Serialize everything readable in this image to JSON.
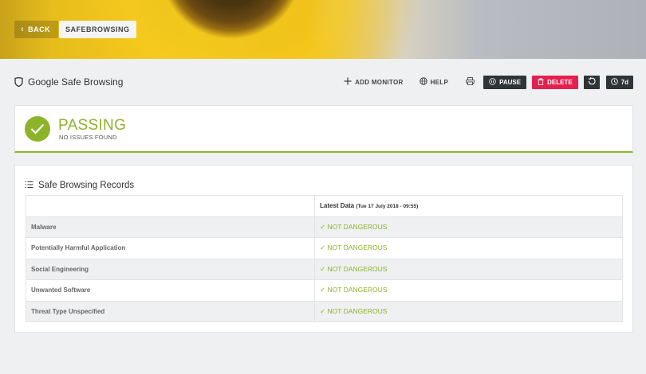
{
  "banner": {
    "back_label": "BACK",
    "breadcrumb": "SAFEBROWSING"
  },
  "header": {
    "title": "Google Safe Browsing",
    "add_monitor": "ADD MONITOR",
    "help": "HELP",
    "pause": "PAUSE",
    "delete": "DELETE",
    "range": "7d"
  },
  "status": {
    "title": "PASSING",
    "subtitle": "NO ISSUES FOUND"
  },
  "records": {
    "title": "Safe Browsing Records",
    "column_header": "Latest Data",
    "column_date": "(Tue 17 July 2018 - 09:55)",
    "rows": [
      {
        "label": "Malware",
        "value": "NOT DANGEROUS"
      },
      {
        "label": "Potentially Harmful Application",
        "value": "NOT DANGEROUS"
      },
      {
        "label": "Social Engineering",
        "value": "NOT DANGEROUS"
      },
      {
        "label": "Unwanted Software",
        "value": "NOT DANGEROUS"
      },
      {
        "label": "Threat Type Unspecified",
        "value": "NOT DANGEROUS"
      }
    ]
  },
  "colors": {
    "accent_green": "#8db32a",
    "delete_red": "#e2214f",
    "dark_button": "#2f3437"
  },
  "icons": [
    "chevron-left-icon",
    "shield-icon",
    "plus-icon",
    "globe-icon",
    "printer-icon",
    "pause-icon",
    "trash-icon",
    "refresh-icon",
    "clock-icon",
    "checkmark-icon",
    "list-icon"
  ]
}
